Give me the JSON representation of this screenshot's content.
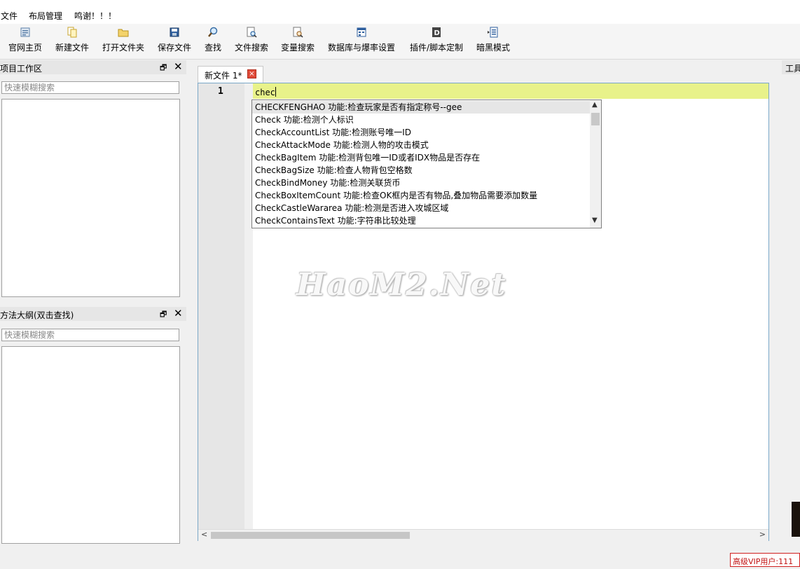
{
  "menu": {
    "items": [
      "文件",
      "布局管理",
      "鸣谢！！！"
    ]
  },
  "toolbar": {
    "buttons": [
      {
        "label": "官网主页",
        "icon": "homepage-icon"
      },
      {
        "label": "新建文件",
        "icon": "new-file-icon"
      },
      {
        "label": "打开文件夹",
        "icon": "folder-icon"
      },
      {
        "label": "保存文件",
        "icon": "save-icon"
      },
      {
        "label": "查找",
        "icon": "find-icon"
      },
      {
        "label": "文件搜索",
        "icon": "file-search-icon"
      },
      {
        "label": "变量搜索",
        "icon": "variable-search-icon"
      },
      {
        "label": "数据库与爆率设置",
        "icon": "database-icon"
      },
      {
        "label": "插件/脚本定制",
        "icon": "plugin-icon"
      },
      {
        "label": "暗黑模式",
        "icon": "dark-mode-icon"
      }
    ]
  },
  "project_panel": {
    "title": "项目工作区",
    "search_placeholder": "快速模糊搜索"
  },
  "outline_panel": {
    "title": "方法大纲(双击查找)",
    "search_placeholder": "快速模糊搜索"
  },
  "editor": {
    "tab_label": "新文件  1*",
    "line_number": "1",
    "code_text": "chec",
    "watermark": "HaoM2.Net"
  },
  "autocomplete": {
    "items": [
      "CHECKFENGHAO 功能:检查玩家是否有指定称号--gee",
      "Check 功能:检测个人标识",
      "CheckAccountList 功能:检测账号唯一ID",
      "CheckAttackMode 功能:检测人物的攻击模式",
      "CheckBagItem 功能:检测背包唯一ID或者IDX物品是否存在",
      "CheckBagSize 功能:检查人物背包空格数",
      "CheckBindMoney 功能:检测关联货币",
      "CheckBoxItemCount 功能:检查OK框内是否有物品,叠加物品需要添加数量",
      "CheckCastleWararea 功能:检测是否进入攻城区域",
      "CheckContainsText 功能:字符串比较处理"
    ],
    "selected_index": 0
  },
  "right_panel": {
    "title": "工具"
  },
  "status": {
    "vip_text": "高级VIP用户:111"
  }
}
